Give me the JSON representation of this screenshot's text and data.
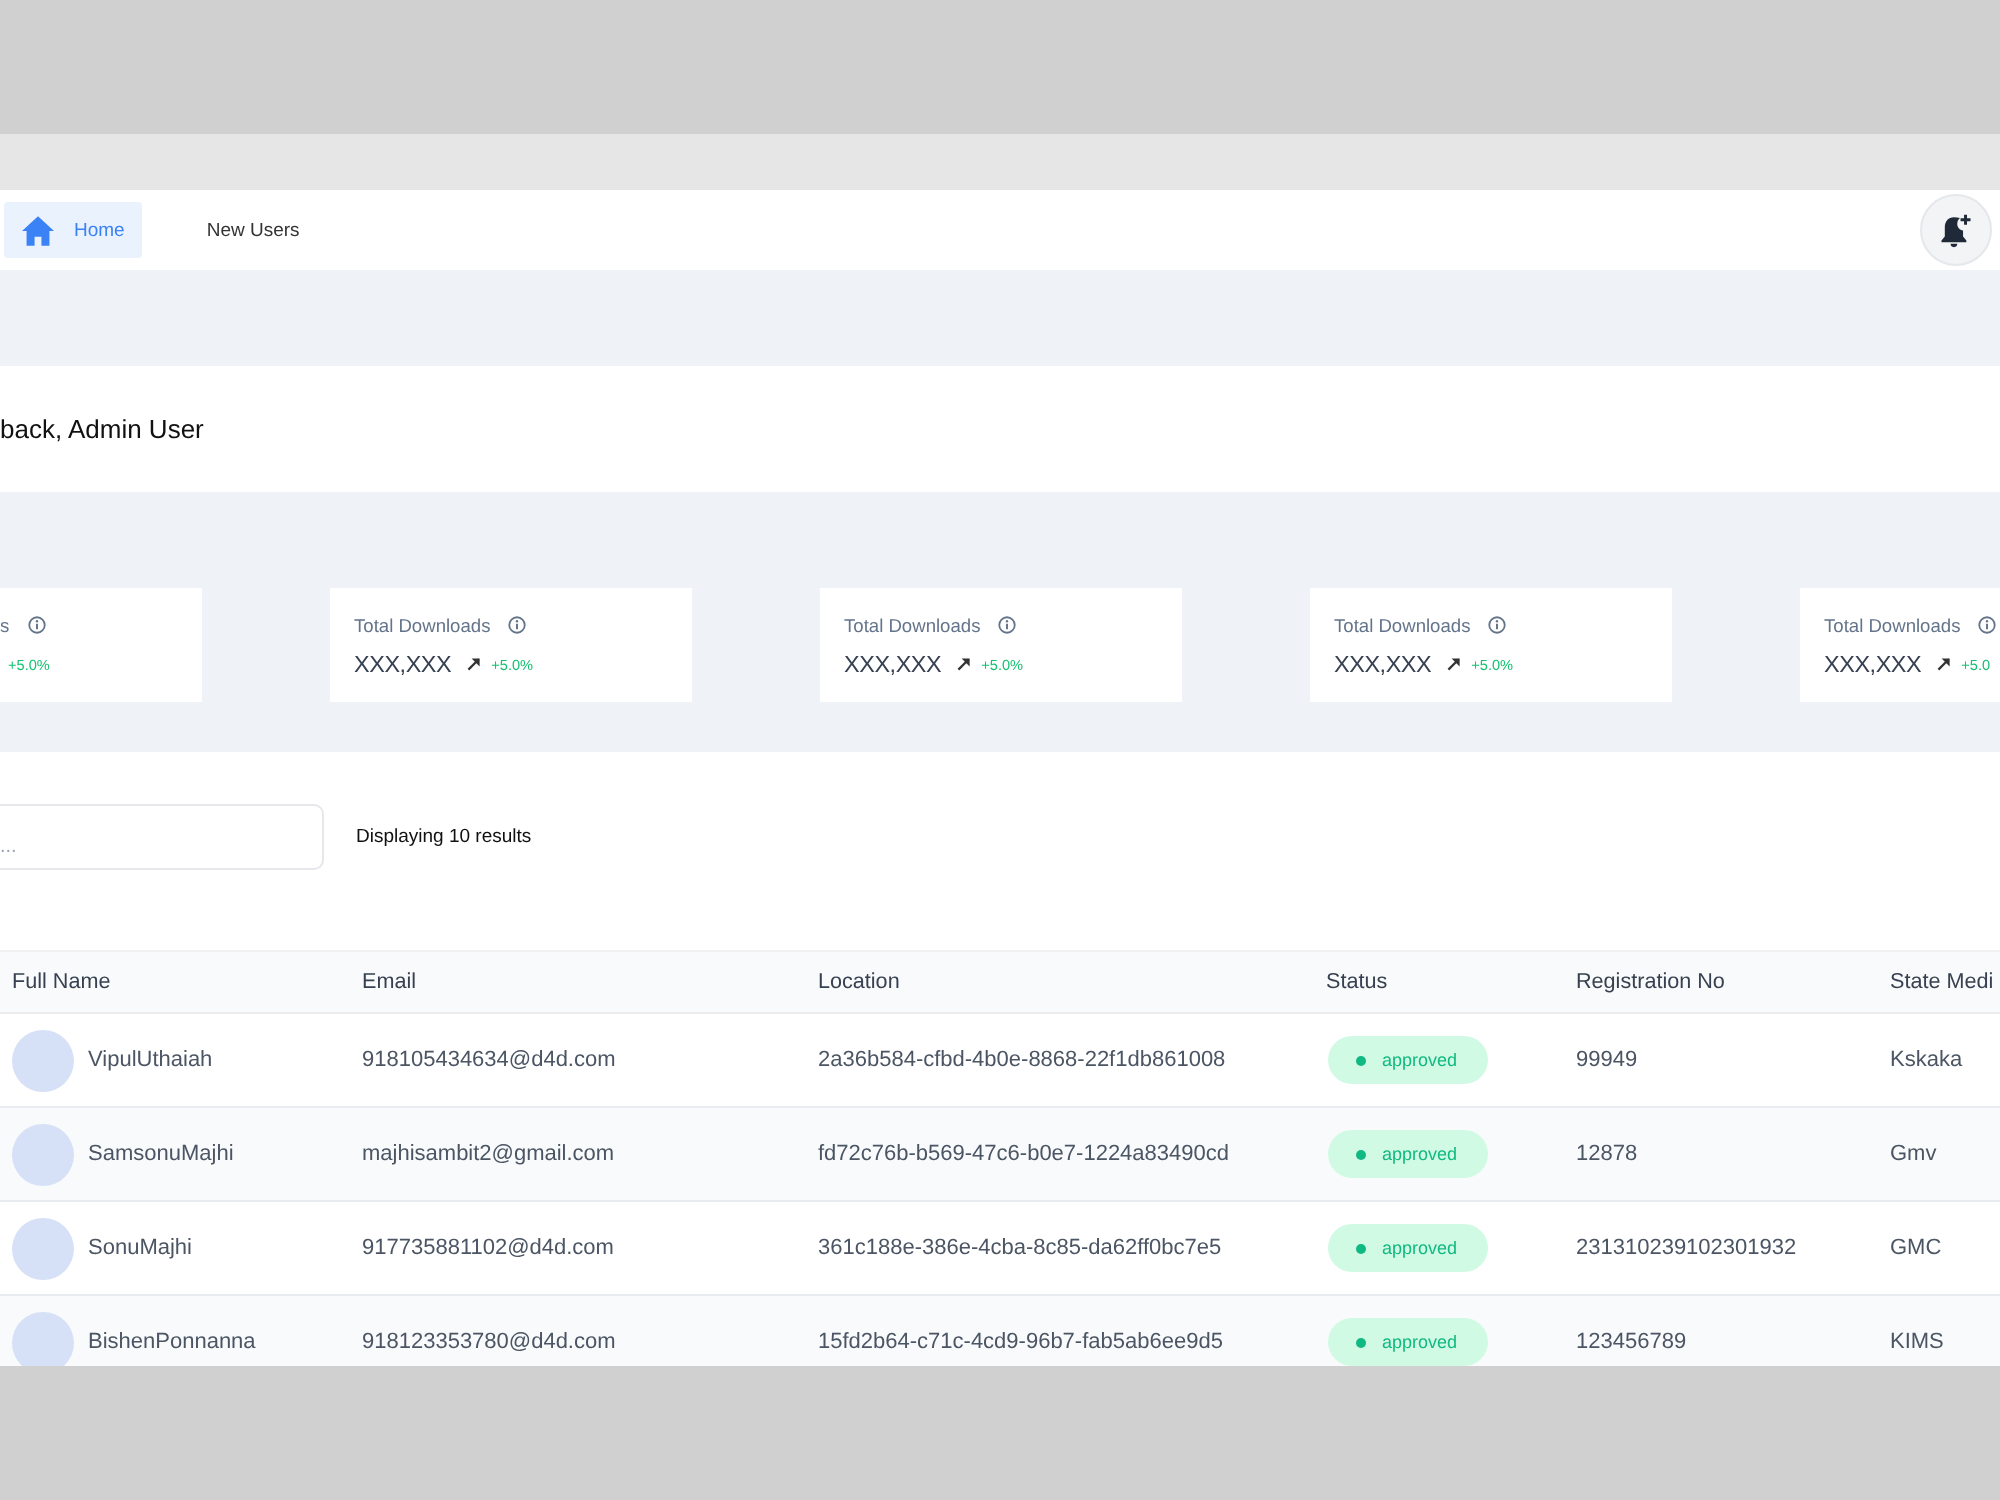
{
  "nav": {
    "tabs": [
      {
        "kind": "home",
        "label": "Home",
        "selected": true
      },
      {
        "kind": "link",
        "label": "New Users",
        "selected": false
      }
    ]
  },
  "greeting": "back, Admin User",
  "stats": {
    "cards": [
      {
        "label": "s",
        "change": "+5.0%"
      },
      {
        "label": "Total Downloads",
        "value": "XXX,XXX",
        "change": "+5.0%"
      },
      {
        "label": "Total Downloads",
        "value": "XXX,XXX",
        "change": "+5.0%"
      },
      {
        "label": "Total Downloads",
        "value": "XXX,XXX",
        "change": "+5.0%"
      },
      {
        "label": "Total Downloads",
        "value": "XXX,XXX",
        "change": "+5.0"
      }
    ]
  },
  "search": {
    "placeholder": "..."
  },
  "results": "Displaying 10 results",
  "table": {
    "columns": [
      "Full Name",
      "Email",
      "Location",
      "Status",
      "Registration No",
      "State Medi"
    ],
    "rows": [
      {
        "name": "VipulUthaiah",
        "email": "918105434634@d4d.com",
        "location": "2a36b584-cfbd-4b0e-8868-22f1db861008",
        "status": "approved",
        "registration_no": "99949",
        "column_6": "Kskaka"
      },
      {
        "name": "SamsonuMajhi",
        "email": "majhisambit2@gmail.com",
        "location": "fd72c76b-b569-47c6-b0e7-1224a83490cd",
        "status": "approved",
        "registration_no": "12878",
        "column_6": "Gmv"
      },
      {
        "name": "SonuMajhi",
        "email": "917735881102@d4d.com",
        "location": "361c188e-386e-4cba-8c85-da62ff0bc7e5",
        "status": "approved",
        "registration_no": "231310239102301932",
        "column_6": "GMC"
      },
      {
        "name": "BishenPonnanna",
        "email": "918123353780@d4d.com",
        "location": "15fd2b64-c71c-4cd9-96b7-fab5ab6ee9d5",
        "status": "approved",
        "registration_no": "123456789",
        "column_6": "KIMS"
      }
    ]
  }
}
